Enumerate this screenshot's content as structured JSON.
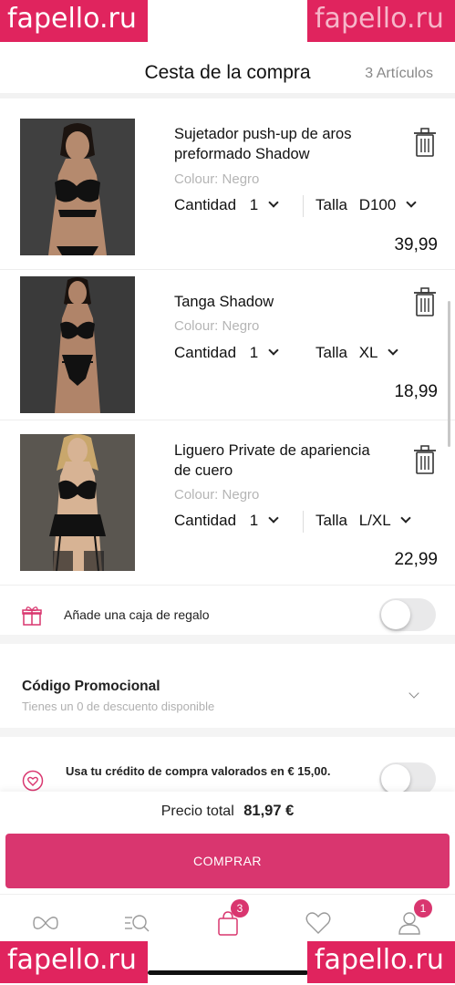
{
  "watermark": "fapello.ru",
  "header": {
    "title": "Cesta de la compra",
    "count": "3 Artículos"
  },
  "items": [
    {
      "name": "Sujetador push-up de aros preformado Shadow",
      "colour": "Colour: Negro",
      "qty_label": "Cantidad",
      "qty": "1",
      "size_label": "Talla",
      "size": "D100",
      "price": "39,99"
    },
    {
      "name": "Tanga Shadow",
      "colour": "Colour: Negro",
      "qty_label": "Cantidad",
      "qty": "1",
      "size_label": "Talla",
      "size": "XL",
      "price": "18,99"
    },
    {
      "name": "Liguero Private de apariencia de cuero",
      "colour": "Colour: Negro",
      "qty_label": "Cantidad",
      "qty": "1",
      "size_label": "Talla",
      "size": "L/XL",
      "price": "22,99"
    }
  ],
  "gift": {
    "label": "Añade una caja de regalo",
    "enabled": false
  },
  "promo": {
    "title": "Código Promocional",
    "subtitle": "Tienes un 0 de descuento disponible"
  },
  "credit": {
    "label": "Usa tu crédito de compra valorados en € 15,00.",
    "enabled": false
  },
  "total": {
    "label": "Precio total",
    "amount": "81,97 €"
  },
  "buy_button": "COMPRAR",
  "tabbar": {
    "cart_badge": "3",
    "account_badge": "1"
  },
  "colors": {
    "accent": "#d9366f",
    "watermark": "#e0245e"
  }
}
